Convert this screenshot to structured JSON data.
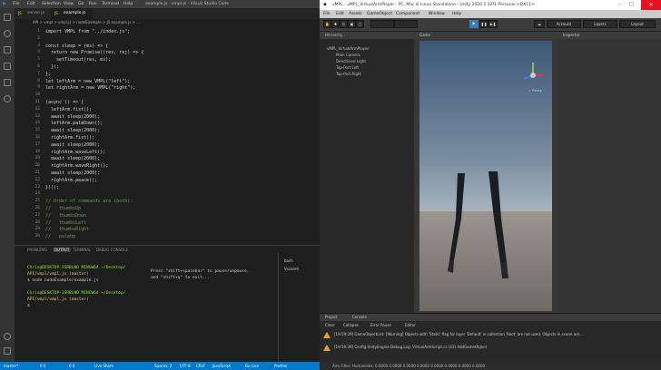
{
  "vscode": {
    "title": {
      "menu": [
        "File",
        "Edit",
        "Selection",
        "View",
        "Go",
        "Run",
        "Terminal",
        "Help"
      ],
      "window_title": "example.js - vmpl-js - Visual Studio Code"
    },
    "tabs": [
      {
        "label": "server.js",
        "badge": "JS"
      },
      {
        "label": "example.js",
        "badge": "JS"
      }
    ],
    "breadcrumb": "API > vmpl > vmpl.js > nodeExample > JS example.js > ...",
    "code_lines": [
      {
        "n": "1",
        "text": "import VMPL from \"../index.js\";",
        "comment": false
      },
      {
        "n": "2",
        "text": "",
        "comment": false
      },
      {
        "n": "3",
        "text": "const sleep = (ms) => {",
        "comment": false
      },
      {
        "n": "4",
        "text": "  return new Promise((res, rej) => {",
        "comment": false
      },
      {
        "n": "5",
        "text": "    setTimeout(res, ms);",
        "comment": false
      },
      {
        "n": "6",
        "text": "  });",
        "comment": false
      },
      {
        "n": "7",
        "text": "};",
        "comment": false
      },
      {
        "n": "8",
        "text": "let leftArm = new VMPL(\"left\");",
        "comment": false
      },
      {
        "n": "9",
        "text": "let rightArm = new VMPL(\"right\");",
        "comment": false
      },
      {
        "n": "10",
        "text": "",
        "comment": false
      },
      {
        "n": "11",
        "text": "(async () => {",
        "comment": false
      },
      {
        "n": "12",
        "text": "  leftArm.fist();",
        "comment": false
      },
      {
        "n": "13",
        "text": "  await sleep(2000);",
        "comment": false
      },
      {
        "n": "14",
        "text": "  leftArm.palmDown();",
        "comment": false
      },
      {
        "n": "15",
        "text": "  await sleep(2000);",
        "comment": false
      },
      {
        "n": "16",
        "text": "  rightArm.fist();",
        "comment": false
      },
      {
        "n": "17",
        "text": "  await sleep(2000);",
        "comment": false
      },
      {
        "n": "18",
        "text": "  rightArm.waveLeft();",
        "comment": false
      },
      {
        "n": "19",
        "text": "  await sleep(2000);",
        "comment": false
      },
      {
        "n": "20",
        "text": "  rightArm.waveRight();",
        "comment": false
      },
      {
        "n": "21",
        "text": "  await sleep(2000);",
        "comment": false
      },
      {
        "n": "22",
        "text": "  rightArm.peace();",
        "comment": false
      },
      {
        "n": "23",
        "text": "})();",
        "comment": false
      },
      {
        "n": "24",
        "text": "",
        "comment": false
      },
      {
        "n": "25",
        "text": "// Order of commands are (both):",
        "comment": true
      },
      {
        "n": "26",
        "text": "//   thumbsUp",
        "comment": true
      },
      {
        "n": "27",
        "text": "//   thumbsDown",
        "comment": true
      },
      {
        "n": "28",
        "text": "//   thumbsLeft",
        "comment": true
      },
      {
        "n": "29",
        "text": "//   thumbsRight",
        "comment": true
      },
      {
        "n": "30",
        "text": "//   palmUp",
        "comment": true
      }
    ],
    "panel_tabs": [
      "PROBLEMS",
      "OUTPUT",
      "TERMINAL",
      "DEBUG CONSOLE"
    ],
    "panel_active": "TERMINAL",
    "terminal_lines": [
      {
        "text": "Chris@DESKTOP-3SRBLNO MINGW64 ~/Desktop/",
        "color": "#8ae234"
      },
      {
        "text": "API/vmpl/vmpl.js (master)",
        "color": "#e5c07b"
      },
      {
        "text": "$ node nodeExample/example.js",
        "color": "#cccccc"
      },
      {
        "text": "",
        "color": "#cccccc"
      },
      {
        "text": "Chris@DESKTOP-3SRBLNO MINGW64 ~/Desktop/",
        "color": "#8ae234"
      },
      {
        "text": "API/vmpl/vmpl.js (master)",
        "color": "#e5c07b"
      },
      {
        "text": "$",
        "color": "#cccccc"
      }
    ],
    "terminal_hint": [
      "Press \"shift+spacebar\" to pause/unpause,",
      "and \"shift+q\" to exit..."
    ],
    "terminal_list": [
      "bash",
      "Vscoreh"
    ],
    "status": [
      "master*",
      "0 0",
      "0 0",
      "Live Share",
      "Spaces: 2",
      "UTF-8",
      "CRLF",
      "JavaScript",
      "Go Live",
      "Prettier"
    ]
  },
  "unity": {
    "title": "vMPL - vMPL_VirtualArmPlayer - PC, Mac & Linux Standalone - Unity 2020.1.12f1 Personal <DX11>",
    "menu": [
      "File",
      "Edit",
      "Assets",
      "GameObject",
      "Component",
      "Window",
      "Help"
    ],
    "toolbar": {
      "account": "Account",
      "layers": "Layers",
      "layout": "Layout"
    },
    "hierarchy": {
      "header": "Hierarchy",
      "items": [
        "vMPL_VirtualArmPlayer",
        "Main Camera",
        "Directional Light",
        "Top-Port:Left",
        "Top-Port:Right"
      ]
    },
    "scene": {
      "header": "Game",
      "gizmo_label": "< Persp"
    },
    "inspector": {
      "header": "Inspector"
    },
    "console": {
      "tabs": [
        "Project",
        "Console"
      ],
      "controls": [
        "Clear",
        "Collapse",
        "Error Pause",
        "Editor"
      ],
      "rows": [
        "[19:59:39] GameObjectList: [Warning] Objects with 'Static' flag for layer 'Default' in collection 'Root' are not used. Objects in scene are...",
        "[19:59:39] Config.UnityEngine.Debug.Log: VirtualArmScript.cs (43) AddGameObject"
      ]
    },
    "status": "Arm Filter: Humanoids: 0.0000 0.0000 0.0000 0.0000 0.0000 0.0000 0.0000 0.0000"
  }
}
